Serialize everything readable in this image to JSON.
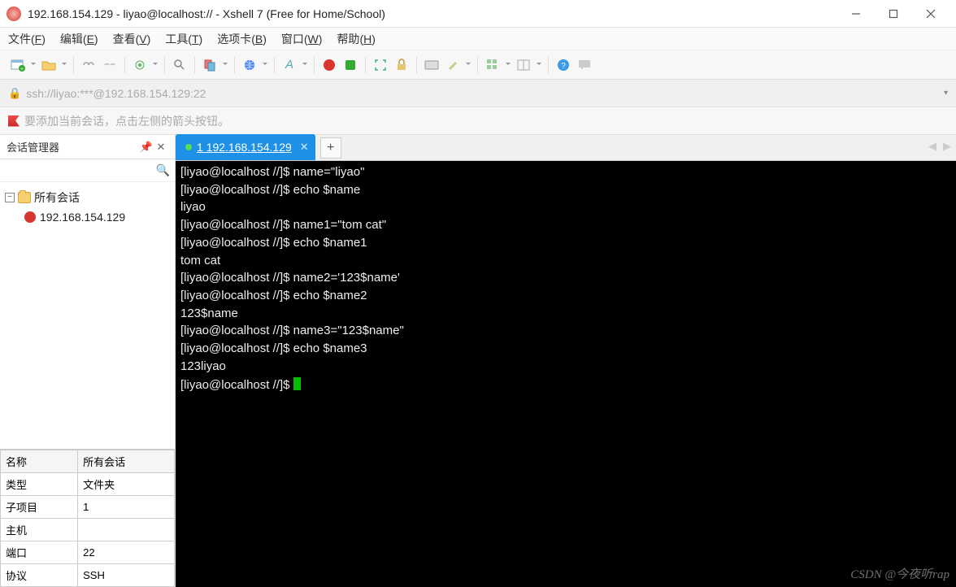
{
  "window": {
    "title": "192.168.154.129 - liyao@localhost:// - Xshell 7 (Free for Home/School)"
  },
  "menu": {
    "file": "文件",
    "file_u": "F",
    "edit": "编辑",
    "edit_u": "E",
    "view": "查看",
    "view_u": "V",
    "tools": "工具",
    "tools_u": "T",
    "tab": "选项卡",
    "tab_u": "B",
    "window": "窗口",
    "window_u": "W",
    "help": "帮助",
    "help_u": "H"
  },
  "address": "ssh://liyao:***@192.168.154.129:22",
  "bookmark_hint": "要添加当前会话，点击左侧的箭头按钮。",
  "sidebar": {
    "title": "会话管理器",
    "root": "所有会话",
    "session": "192.168.154.129"
  },
  "props": {
    "headers": [
      "名称",
      "所有会话"
    ],
    "rows": [
      [
        "类型",
        "文件夹"
      ],
      [
        "子项目",
        "1"
      ],
      [
        "主机",
        ""
      ],
      [
        "端口",
        "22"
      ],
      [
        "协议",
        "SSH"
      ]
    ]
  },
  "tabs": {
    "active_index": "1",
    "active_label": "192.168.154.129"
  },
  "terminal": {
    "lines": [
      "[liyao@localhost //]$ name=\"liyao\"",
      "[liyao@localhost //]$ echo $name",
      "liyao",
      "[liyao@localhost //]$ name1=\"tom cat\"",
      "[liyao@localhost //]$ echo $name1",
      "tom cat",
      "[liyao@localhost //]$ name2='123$name'",
      "[liyao@localhost //]$ echo $name2",
      "123$name",
      "[liyao@localhost //]$ name3=\"123$name\"",
      "[liyao@localhost //]$ echo $name3",
      "123liyao",
      "[liyao@localhost //]$ "
    ]
  },
  "watermark": "CSDN @今夜听rap"
}
